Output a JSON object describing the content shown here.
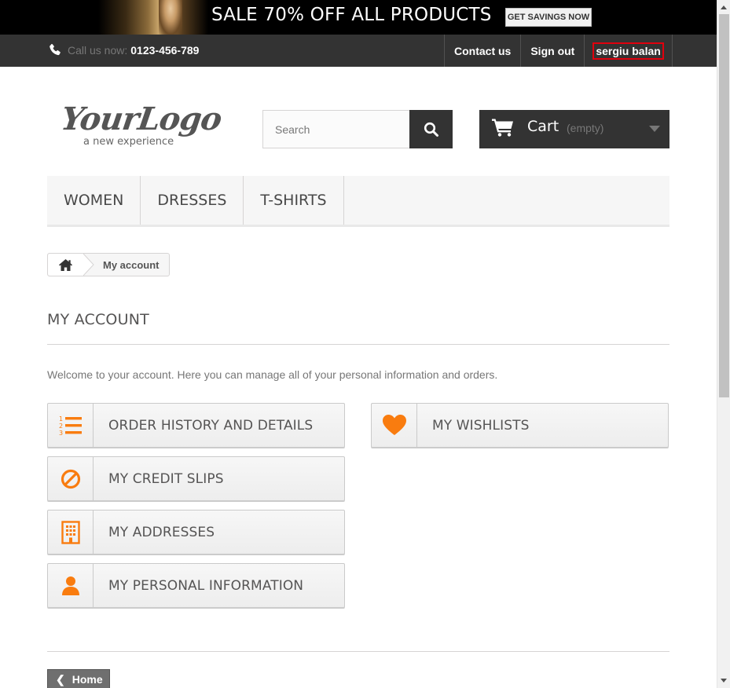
{
  "banner": {
    "text": "SALE 70% OFF ALL PRODUCTS",
    "button_label": "GET SAVINGS NOW"
  },
  "topbar": {
    "call_label": "Call us now:",
    "phone_number": "0123-456-789",
    "links": {
      "contact": "Contact us",
      "signout": "Sign out",
      "user": "sergiu balan"
    }
  },
  "header": {
    "logo_main": "YourLogo",
    "logo_sub": "a new experience",
    "search_placeholder": "Search",
    "cart_label": "Cart",
    "cart_status": "(empty)"
  },
  "menu": {
    "items": [
      "WOMEN",
      "DRESSES",
      "T-SHIRTS"
    ]
  },
  "breadcrumb": {
    "current": "My account"
  },
  "page": {
    "title": "MY ACCOUNT",
    "intro": "Welcome to your account. Here you can manage all of your personal information and orders."
  },
  "account_links": {
    "order_history": "ORDER HISTORY AND DETAILS",
    "credit_slips": "MY CREDIT SLIPS",
    "addresses": "MY ADDRESSES",
    "personal_info": "MY PERSONAL INFORMATION",
    "wishlists": "MY WISHLISTS"
  },
  "footer": {
    "home_label": "Home"
  },
  "colors": {
    "accent": "#f97c0f",
    "dark": "#333333",
    "highlight_border": "#e0000d"
  }
}
